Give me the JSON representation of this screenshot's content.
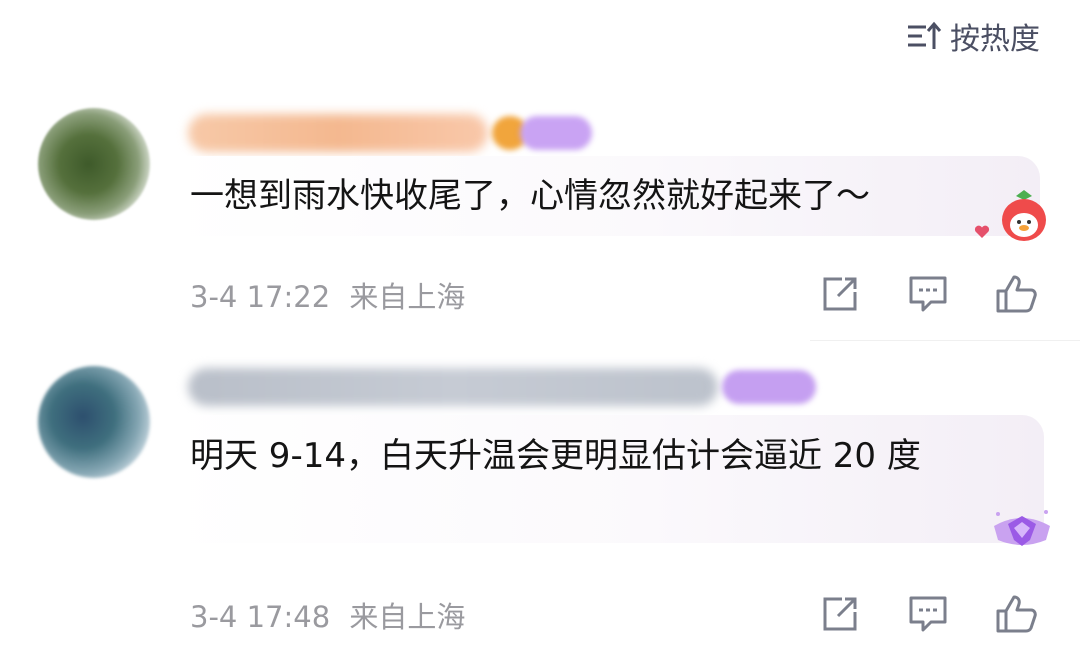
{
  "sort": {
    "label": "按热度"
  },
  "comments": [
    {
      "username": "",
      "text": "一想到雨水快收尾了，心情忽然就好起来了～",
      "time": "3-4 17:22",
      "location": "来自上海"
    },
    {
      "username": "",
      "text": "明天 9-14，白天升温会更明显估计会逼近 20 度",
      "time": "3-4 17:48",
      "location": "来自上海"
    }
  ]
}
